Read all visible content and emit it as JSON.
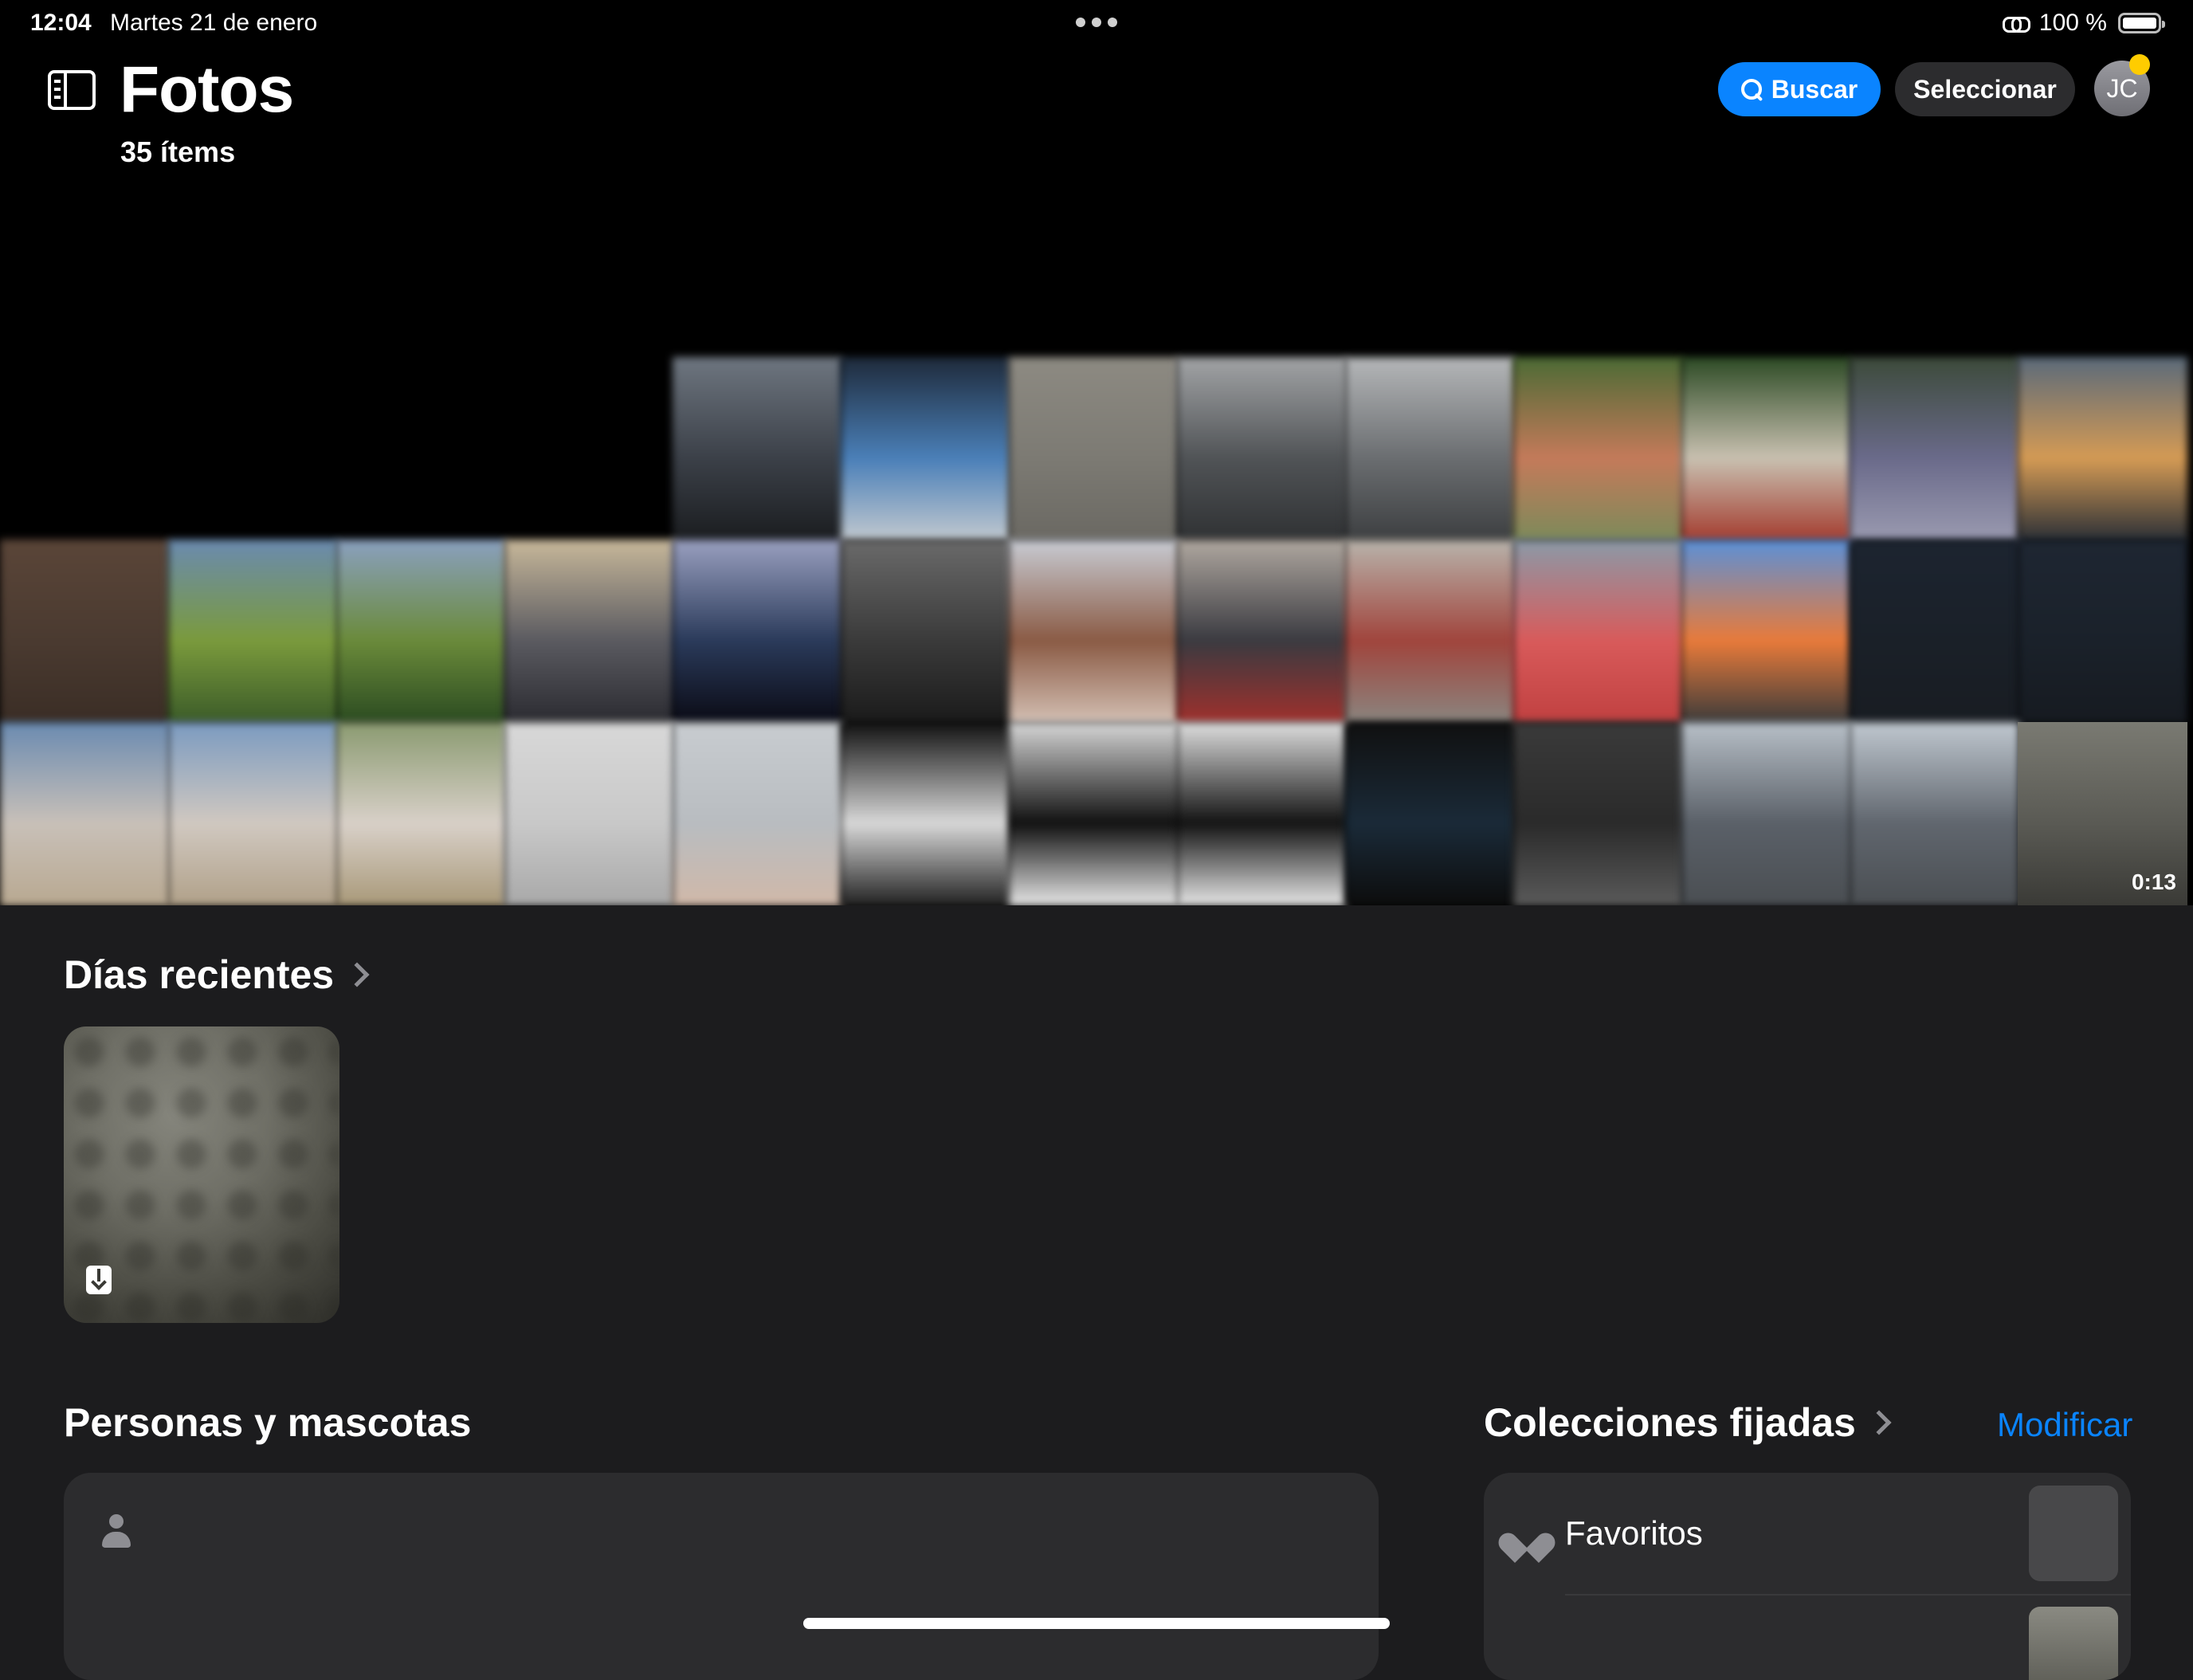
{
  "status_bar": {
    "time": "12:04",
    "date": "Martes 21 de enero",
    "battery": "100 %"
  },
  "header": {
    "title": "Fotos",
    "subtitle": "35 ítems",
    "search_label": "Buscar",
    "select_label": "Seleccionar",
    "avatar_initials": "JC"
  },
  "grid": {
    "tiles": [
      {
        "row": 0,
        "col": 4,
        "colors": [
          "#6e7680",
          "#3b4048",
          "#1a1c1f"
        ]
      },
      {
        "row": 0,
        "col": 5,
        "colors": [
          "#1e2a3a",
          "#4a7fb8",
          "#c2c9cf"
        ]
      },
      {
        "row": 0,
        "col": 6,
        "colors": [
          "#8d8a82",
          "#7c7a73",
          "#6a6862"
        ]
      },
      {
        "row": 0,
        "col": 7,
        "colors": [
          "#a2a4a6",
          "#505356",
          "#2f3133"
        ]
      },
      {
        "row": 0,
        "col": 8,
        "colors": [
          "#b5b7b9",
          "#6a6d70",
          "#3c3e40"
        ]
      },
      {
        "row": 0,
        "col": 9,
        "colors": [
          "#4b6a34",
          "#c47a5a",
          "#7b8a5a"
        ]
      },
      {
        "row": 0,
        "col": 10,
        "colors": [
          "#2c4a24",
          "#c8c0b0",
          "#a33b2e"
        ]
      },
      {
        "row": 0,
        "col": 11,
        "colors": [
          "#3c4a3a",
          "#6a6a8a",
          "#9a9ab0"
        ]
      },
      {
        "row": 0,
        "col": 12,
        "colors": [
          "#5a6a7a",
          "#d49a54",
          "#2a2f36"
        ]
      },
      {
        "row": 1,
        "col": 0,
        "colors": [
          "#5a4538",
          "#4a3a30",
          "#3a2d25"
        ]
      },
      {
        "row": 1,
        "col": 1,
        "colors": [
          "#6a8ab0",
          "#7a9a3c",
          "#3a5a28"
        ]
      },
      {
        "row": 1,
        "col": 2,
        "colors": [
          "#8aa0c0",
          "#6a8a3a",
          "#2a4a20"
        ]
      },
      {
        "row": 1,
        "col": 3,
        "colors": [
          "#c8b89a",
          "#5a5a60",
          "#2a2a30"
        ]
      },
      {
        "row": 1,
        "col": 4,
        "colors": [
          "#9aa0c0",
          "#2a3a5a",
          "#0a0a14"
        ]
      },
      {
        "row": 1,
        "col": 5,
        "colors": [
          "#6a6a6a",
          "#3a3a3a",
          "#1a1a1a"
        ]
      },
      {
        "row": 1,
        "col": 6,
        "colors": [
          "#c8ccd4",
          "#8a5a44",
          "#d4c0b4"
        ]
      },
      {
        "row": 1,
        "col": 7,
        "colors": [
          "#b0a8a0",
          "#3a3a40",
          "#a0302c"
        ]
      },
      {
        "row": 1,
        "col": 8,
        "colors": [
          "#b8b4ac",
          "#a0443c",
          "#8a8680"
        ]
      },
      {
        "row": 1,
        "col": 9,
        "colors": [
          "#8a9aa8",
          "#d85a5a",
          "#c04040"
        ]
      },
      {
        "row": 1,
        "col": 10,
        "colors": [
          "#5a90d8",
          "#e87a3a",
          "#3a3a3a"
        ]
      },
      {
        "row": 1,
        "col": 11,
        "colors": [
          "#1c2430",
          "#1a2028",
          "#181c22"
        ]
      },
      {
        "row": 1,
        "col": 12,
        "colors": [
          "#1e2632",
          "#1a212a",
          "#161a20"
        ]
      },
      {
        "row": 2,
        "col": 0,
        "colors": [
          "#6a8ab0",
          "#c8c0b8",
          "#b8a890"
        ]
      },
      {
        "row": 2,
        "col": 1,
        "colors": [
          "#7a9ac0",
          "#d0c8c0",
          "#b0a088"
        ]
      },
      {
        "row": 2,
        "col": 2,
        "colors": [
          "#8a9a70",
          "#d8d0c8",
          "#a89878"
        ]
      },
      {
        "row": 2,
        "col": 3,
        "colors": [
          "#d8d8d8",
          "#c8c8c8",
          "#a8a8a8"
        ]
      },
      {
        "row": 2,
        "col": 4,
        "colors": [
          "#c8ccd0",
          "#b8bcc0",
          "#d0b8a8"
        ]
      },
      {
        "row": 2,
        "col": 5,
        "colors": [
          "#101010",
          "#d8d8d8",
          "#202020"
        ]
      },
      {
        "row": 2,
        "col": 6,
        "colors": [
          "#d8d8d8",
          "#101010",
          "#e8e8e8"
        ]
      },
      {
        "row": 2,
        "col": 7,
        "colors": [
          "#e0e0e0",
          "#121212",
          "#e8e8e8"
        ]
      },
      {
        "row": 2,
        "col": 8,
        "colors": [
          "#101010",
          "#1a2a38",
          "#0c0c0c"
        ]
      },
      {
        "row": 2,
        "col": 9,
        "colors": [
          "#3a3a3a",
          "#2a2a2a",
          "#5a5a5a"
        ]
      },
      {
        "row": 2,
        "col": 10,
        "colors": [
          "#b8c0c8",
          "#5a6068",
          "#4a4e52"
        ]
      },
      {
        "row": 2,
        "col": 11,
        "colors": [
          "#c0c8d0",
          "#60666e",
          "#4a4e52"
        ]
      },
      {
        "row": 2,
        "col": 12,
        "colors": [
          "#7a7a72",
          "#5a5a54",
          "#3a3a36"
        ]
      }
    ],
    "video_duration": "0:13"
  },
  "recent_days": {
    "heading": "Días recientes"
  },
  "people": {
    "heading": "Personas y mascotas"
  },
  "collections": {
    "heading": "Colecciones fijadas",
    "edit_label": "Modificar",
    "first_item": "Favoritos"
  },
  "colors": {
    "accent": "#0a84ff",
    "background": "#1c1c1e",
    "card": "#2c2c2e",
    "badge": "#ffcc00"
  }
}
